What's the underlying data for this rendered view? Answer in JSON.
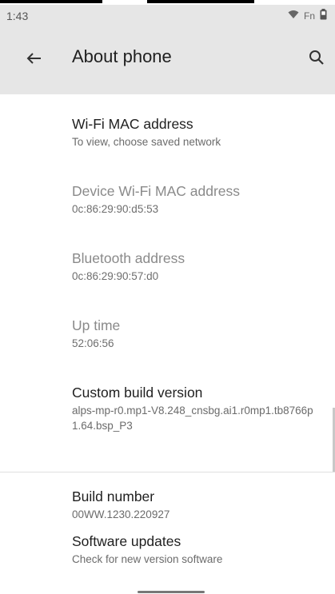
{
  "status_bar": {
    "time": "1:43",
    "indicator_text": "Fn"
  },
  "app_bar": {
    "title": "About phone"
  },
  "items": [
    {
      "title": "Wi-Fi MAC address",
      "subtitle": "To view, choose saved network",
      "enabled": true
    },
    {
      "title": "Device Wi-Fi MAC address",
      "subtitle": "0c:86:29:90:d5:53",
      "enabled": false
    },
    {
      "title": "Bluetooth address",
      "subtitle": "0c:86:29:90:57:d0",
      "enabled": false
    },
    {
      "title": "Up time",
      "subtitle": "52:06:56",
      "enabled": false
    },
    {
      "title": "Custom build version",
      "subtitle": "alps-mp-r0.mp1-V8.248_cnsbg.ai1.r0mp1.tb8766p1.64.bsp_P3",
      "enabled": true
    },
    {
      "title": "Build number",
      "subtitle": "00WW.1230.220927",
      "enabled": true
    },
    {
      "title": "Software updates",
      "subtitle": "Check for new version software",
      "enabled": true
    }
  ],
  "colors": {
    "app_bar_bg": "#e6e6e6",
    "primary_text": "#1f1f1f",
    "secondary_text": "#6b6b6b",
    "disabled_text": "#8a8a8a"
  }
}
